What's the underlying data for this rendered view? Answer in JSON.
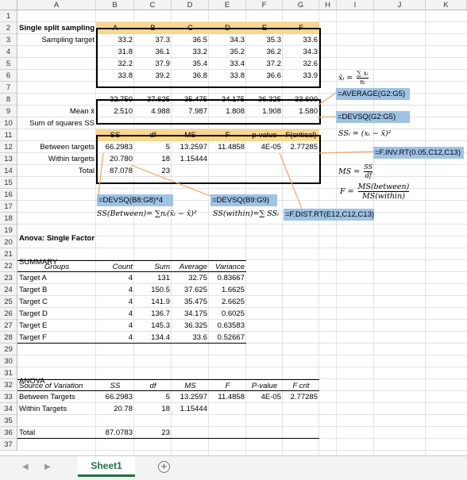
{
  "columns": [
    "A",
    "B",
    "C",
    "D",
    "E",
    "F",
    "G",
    "H",
    "I",
    "J",
    "K"
  ],
  "rows": [
    "1",
    "2",
    "3",
    "4",
    "5",
    "6",
    "7",
    "8",
    "9",
    "10",
    "11",
    "12",
    "13",
    "14",
    "15",
    "16",
    "17",
    "18",
    "19",
    "20",
    "21",
    "22",
    "23",
    "24",
    "25",
    "26",
    "27",
    "28",
    "29",
    "30",
    "31",
    "32",
    "33",
    "34",
    "35",
    "36",
    "37"
  ],
  "title": "Single split sampling procedure  -  One-factor ANOVA",
  "sampling": {
    "label": "Sampling target",
    "targets": [
      "A",
      "B",
      "C",
      "D",
      "E",
      "F"
    ],
    "data": [
      [
        "33.2",
        "37.3",
        "36.5",
        "34.3",
        "35.3",
        "33.6"
      ],
      [
        "31.8",
        "36.1",
        "33.2",
        "35.2",
        "36.2",
        "34.3"
      ],
      [
        "32.2",
        "37.9",
        "35.4",
        "33.4",
        "37.2",
        "32.6"
      ],
      [
        "33.8",
        "39.2",
        "36.8",
        "33.8",
        "36.6",
        "33.9"
      ]
    ],
    "mean_label": "Mean x̄",
    "means": [
      "32.750",
      "37.625",
      "35.475",
      "34.175",
      "36.325",
      "33.600"
    ],
    "ss_label": "Sum of squares SS",
    "ss": [
      "2.510",
      "4.988",
      "7.987",
      "1.808",
      "1.908",
      "1.580"
    ]
  },
  "notes": {
    "average_formula": "=AVERAGE(G2:G5)",
    "devsq_formula": "=DEVSQ(G2:G5)",
    "finv_formula": "=F.INV.RT(0.05,C12,C13)",
    "devsq_between": "=DEVSQ(B8:G8)*4",
    "devsq_within": "=DEVSQ(B9:G9)",
    "fdist_formula": "=F.DIST.RT(E12,C12,C13)",
    "ss_between_label": "SS(Between)= ∑nᵢ(x̄ᵢ − x̄)²",
    "ss_within_label": "SS(within)=∑ SSᵢ",
    "xbar_formula_lhs": "x̄ᵢ =",
    "xbar_num": "∑ xᵢ",
    "xbar_den": "nᵢ",
    "ssi_formula": "SSᵢ = (xᵢ − x̄)²",
    "ms_lhs": "MS =",
    "ms_num": "SS",
    "ms_den": "df",
    "f_lhs": "F =",
    "f_num": "MS(between)",
    "f_den": "MS(within)"
  },
  "anova_calc": {
    "headers": [
      "SS",
      "df",
      "MS",
      "F",
      "p-value",
      "F(critical)"
    ],
    "rows": [
      {
        "label": "Between targets",
        "values": [
          "66.2983",
          "5",
          "13.2597",
          "11.4858",
          "4E-05",
          "2.77285"
        ]
      },
      {
        "label": "Within targets",
        "values": [
          "20.780",
          "18",
          "1.15444",
          "",
          "",
          ""
        ]
      },
      {
        "label": "Total",
        "values": [
          "87.078",
          "23",
          "",
          "",
          "",
          ""
        ]
      }
    ]
  },
  "anova_title": "Anova: Single Factor",
  "summary": {
    "label": "SUMMARY",
    "headers": [
      "Groups",
      "Count",
      "Sum",
      "Average",
      "Variance"
    ],
    "rows": [
      [
        "Target A",
        "4",
        "131",
        "32.75",
        "0.83667"
      ],
      [
        "Target B",
        "4",
        "150.5",
        "37.625",
        "1.6625"
      ],
      [
        "Target C",
        "4",
        "141.9",
        "35.475",
        "2.6625"
      ],
      [
        "Target D",
        "4",
        "136.7",
        "34.175",
        "0.6025"
      ],
      [
        "Target E",
        "4",
        "145.3",
        "36.325",
        "0.63583"
      ],
      [
        "Target F",
        "4",
        "134.4",
        "33.6",
        "0.52667"
      ]
    ]
  },
  "anova": {
    "label": "ANOVA",
    "headers": [
      "Source of Variation",
      "SS",
      "df",
      "MS",
      "F",
      "P-value",
      "F crit"
    ],
    "rows": [
      [
        "Between Targets",
        "66.2983",
        "5",
        "13.2597",
        "11.4858",
        "4E-05",
        "2.77285"
      ],
      [
        "Within Targets",
        "20.78",
        "18",
        "1.15444",
        "",
        "",
        ""
      ]
    ],
    "total": [
      "Total",
      "87.0783",
      "23",
      "",
      "",
      "",
      ""
    ]
  },
  "tabs": {
    "sheet": "Sheet1",
    "add": "+"
  },
  "colors": {
    "orange_fill": "#fbd787",
    "blue_fill": "#9dc3e6",
    "tab_green": "#1f7145",
    "arrow_orange": "#f4a460"
  }
}
